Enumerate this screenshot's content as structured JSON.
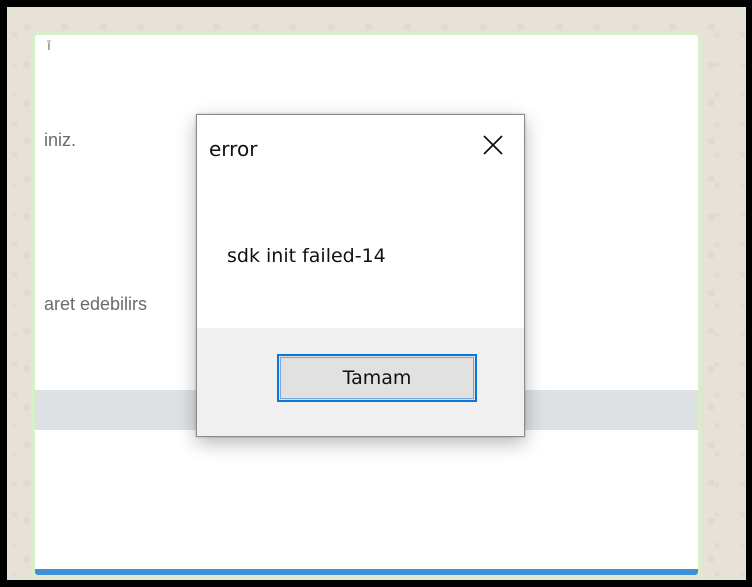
{
  "background_window": {
    "top_mark": "ī",
    "text_line_1": "iniz.",
    "text_line_2": "aret edebilirs"
  },
  "dialog": {
    "title": "error",
    "message": "sdk init failed-14",
    "ok_label": "Tamam",
    "close_icon": "close-icon"
  },
  "colors": {
    "accent_blue": "#3f8fd8",
    "button_focus_border": "#0a76d6",
    "footer_gray": "#f0f0f0",
    "band_gray": "#dde1e3",
    "window_border_green": "#d8f0c8"
  }
}
